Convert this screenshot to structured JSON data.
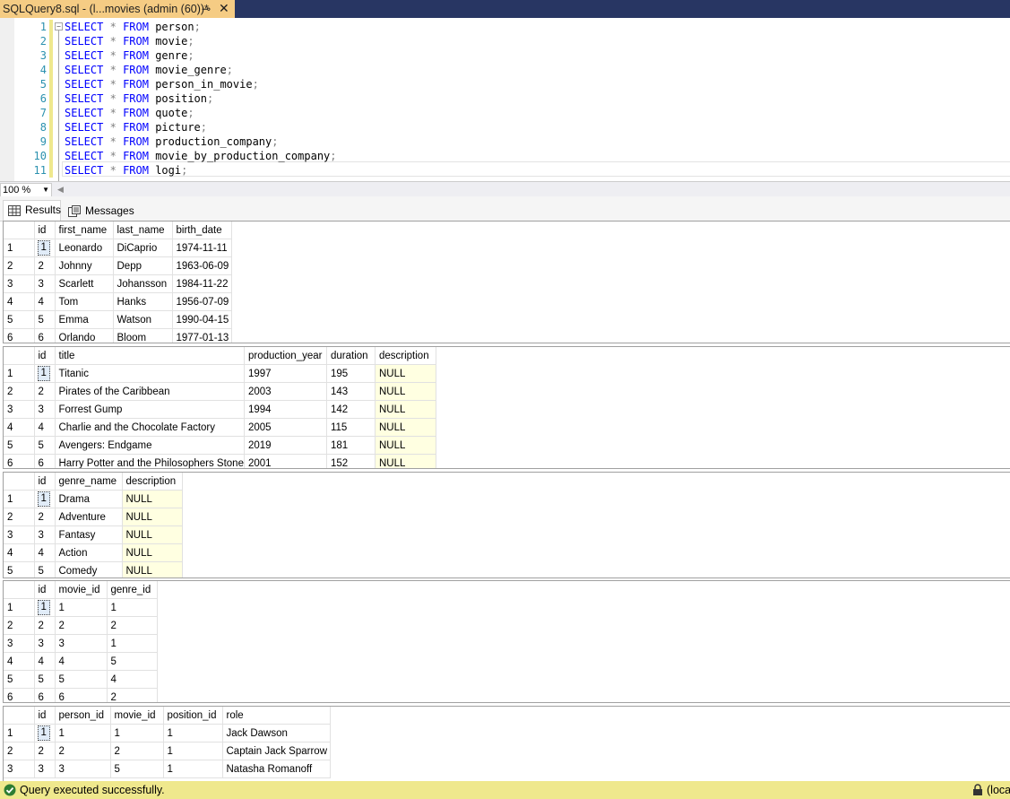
{
  "tab": {
    "title": "SQLQuery8.sql - (l...movies (admin (60))*",
    "pin": "⊸",
    "close": "✕"
  },
  "editor": {
    "lines": [
      {
        "n": "1",
        "table": "person"
      },
      {
        "n": "2",
        "table": "movie"
      },
      {
        "n": "3",
        "table": "genre"
      },
      {
        "n": "4",
        "table": "movie_genre"
      },
      {
        "n": "5",
        "table": "person_in_movie"
      },
      {
        "n": "6",
        "table": "position"
      },
      {
        "n": "7",
        "table": "quote"
      },
      {
        "n": "8",
        "table": "picture"
      },
      {
        "n": "9",
        "table": "production_company"
      },
      {
        "n": "10",
        "table": "movie_by_production_company"
      },
      {
        "n": "11",
        "table": "logi"
      }
    ],
    "kw_select": "SELECT",
    "kw_star": "*",
    "kw_from": "FROM",
    "semicolon": ";"
  },
  "zoom": {
    "value": "100 %"
  },
  "result_tabs": {
    "results": "Results",
    "messages": "Messages"
  },
  "grids": [
    {
      "columns": [
        "id",
        "first_name",
        "last_name",
        "birth_date"
      ],
      "rows": [
        [
          "1",
          "1",
          "Leonardo",
          "DiCaprio",
          "1974-11-11"
        ],
        [
          "2",
          "2",
          "Johnny",
          "Depp",
          "1963-06-09"
        ],
        [
          "3",
          "3",
          "Scarlett",
          "Johansson",
          "1984-11-22"
        ],
        [
          "4",
          "4",
          "Tom",
          "Hanks",
          "1956-07-09"
        ],
        [
          "5",
          "5",
          "Emma",
          "Watson",
          "1990-04-15"
        ],
        [
          "6",
          "6",
          "Orlando",
          "Bloom",
          "1977-01-13"
        ]
      ]
    },
    {
      "columns": [
        "id",
        "title",
        "production_year",
        "duration",
        "description"
      ],
      "rows": [
        [
          "1",
          "1",
          "Titanic",
          "1997",
          "195",
          "NULL"
        ],
        [
          "2",
          "2",
          "Pirates of the Caribbean",
          "2003",
          "143",
          "NULL"
        ],
        [
          "3",
          "3",
          "Forrest Gump",
          "1994",
          "142",
          "NULL"
        ],
        [
          "4",
          "4",
          "Charlie and the Chocolate Factory",
          "2005",
          "115",
          "NULL"
        ],
        [
          "5",
          "5",
          "Avengers: Endgame",
          "2019",
          "181",
          "NULL"
        ],
        [
          "6",
          "6",
          "Harry Potter and the Philosophers Stone",
          "2001",
          "152",
          "NULL"
        ]
      ]
    },
    {
      "columns": [
        "id",
        "genre_name",
        "description"
      ],
      "rows": [
        [
          "1",
          "1",
          "Drama",
          "NULL"
        ],
        [
          "2",
          "2",
          "Adventure",
          "NULL"
        ],
        [
          "3",
          "3",
          "Fantasy",
          "NULL"
        ],
        [
          "4",
          "4",
          "Action",
          "NULL"
        ],
        [
          "5",
          "5",
          "Comedy",
          "NULL"
        ]
      ]
    },
    {
      "columns": [
        "id",
        "movie_id",
        "genre_id"
      ],
      "rows": [
        [
          "1",
          "1",
          "1",
          "1"
        ],
        [
          "2",
          "2",
          "2",
          "2"
        ],
        [
          "3",
          "3",
          "3",
          "1"
        ],
        [
          "4",
          "4",
          "4",
          "5"
        ],
        [
          "5",
          "5",
          "5",
          "4"
        ],
        [
          "6",
          "6",
          "6",
          "2"
        ]
      ]
    },
    {
      "columns": [
        "id",
        "person_id",
        "movie_id",
        "position_id",
        "role"
      ],
      "rows": [
        [
          "1",
          "1",
          "1",
          "1",
          "1",
          "Jack Dawson"
        ],
        [
          "2",
          "2",
          "2",
          "2",
          "1",
          "Captain Jack Sparrow"
        ],
        [
          "3",
          "3",
          "3",
          "5",
          "1",
          "Natasha Romanoff"
        ]
      ]
    }
  ],
  "status": {
    "message": "Query executed successfully.",
    "server": "(loca"
  },
  "colors": {
    "tab_strip": "#283663",
    "active_tab": "#f5cc84",
    "status_bar": "#efe88d",
    "keyword": "#0000ff",
    "line_number": "#2b91af",
    "null_cell": "#ffffe1"
  }
}
